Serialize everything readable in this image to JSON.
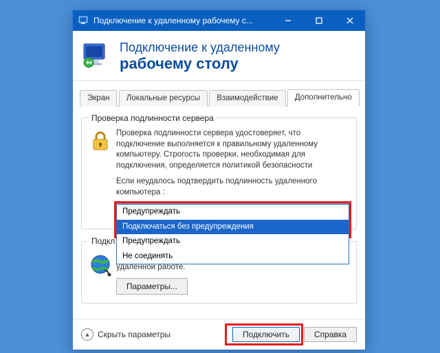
{
  "titlebar": {
    "title": "Подключение к удаленному рабочему с..."
  },
  "banner": {
    "line1": "Подключение к удаленному",
    "line2": "рабочему столу"
  },
  "tabs": {
    "items": [
      "Экран",
      "Локальные ресурсы",
      "Взаимодействие",
      "Дополнительно"
    ],
    "active_index": 3
  },
  "auth_group": {
    "legend": "Проверка подлинности сервера",
    "desc": "Проверка подлинности сервера удостоверяет, что подключение выполняется к правильному удаленному компьютеру. Строгость проверки, необходимая для подключения, определяется политикой безопасности",
    "prompt": "Если неудалось подтвердить подлинность удаленного компьютера :",
    "dropdown": {
      "selected_index": 1,
      "options": [
        "Предупреждать",
        "Подключаться без предупреждения",
        "Предупреждать",
        "Не соединять"
      ]
    }
  },
  "gateway_group": {
    "legend": "Подкл",
    "desc": "Настройка параметров для подключения через шлюз при удаленной работе.",
    "button": "Параметры..."
  },
  "bottom": {
    "hide_params": "Скрыть параметры",
    "connect": "Подключить",
    "help": "Справка"
  }
}
